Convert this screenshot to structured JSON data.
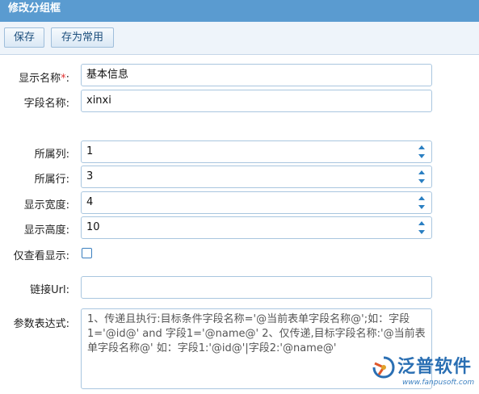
{
  "window": {
    "title": "修改分组框"
  },
  "toolbar": {
    "save_label": "保存",
    "save_common_label": "存为常用"
  },
  "form": {
    "display_name": {
      "label": "显示名称",
      "required_mark": "*",
      "colon": ":",
      "value": "基本信息"
    },
    "field_name": {
      "label": "字段名称:",
      "value": "xinxi"
    },
    "column": {
      "label": "所属列:",
      "value": "1"
    },
    "row": {
      "label": "所属行:",
      "value": "3"
    },
    "width": {
      "label": "显示宽度:",
      "value": "4"
    },
    "height": {
      "label": "显示高度:",
      "value": "10"
    },
    "view_only": {
      "label": "仅查看显示:",
      "checked": false
    },
    "link_url": {
      "label": "链接Url:",
      "value": ""
    },
    "param_expr": {
      "label": "参数表达式:",
      "value": "1、传递且执行:目标条件字段名称='@当前表单字段名称@';如：字段1='@id@' and 字段1='@name@'    2、仅传递,目标字段名称:'@当前表单字段名称@' 如：字段1:'@id@'|字段2:'@name@'"
    }
  },
  "watermark": {
    "name": "泛普软件",
    "url": "www.fanpusoft.com"
  },
  "colors": {
    "titlebar": "#5a9bd0",
    "accent": "#2a7fc2",
    "required": "#e03232"
  }
}
